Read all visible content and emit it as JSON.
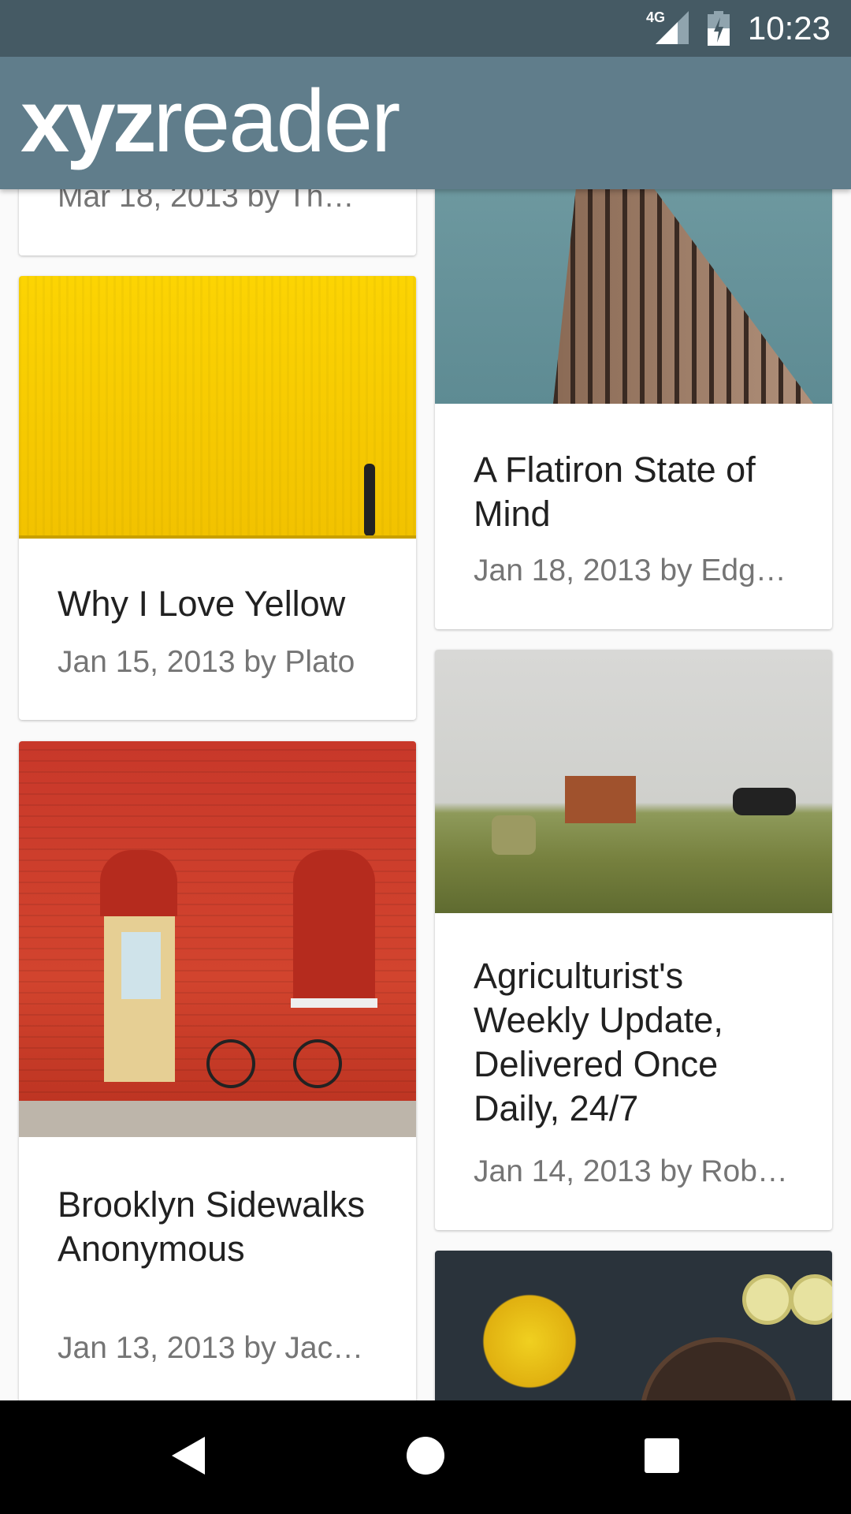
{
  "status_bar": {
    "network": "4G",
    "time": "10:23"
  },
  "toolbar": {
    "logo_bold": "xyz",
    "logo_light": "reader"
  },
  "articles": [
    {
      "title": "",
      "meta": "Mar 18, 2013 by Th…"
    },
    {
      "title": "Why I Love Yellow",
      "meta": "Jan 15, 2013 by Plato"
    },
    {
      "title": "Brooklyn Sidewalks Anonymous",
      "meta": "Jan 13, 2013 by Jac…"
    },
    {
      "title": "A Flatiron State of Mind",
      "meta": "Jan 18, 2013 by Edg…"
    },
    {
      "title": "Agriculturist's Weekly Update, Delivered Once Daily, 24/7",
      "meta": "Jan 14, 2013 by Rob…"
    }
  ],
  "nav": {
    "back": "back-icon",
    "home": "home-icon",
    "recents": "recents-icon"
  }
}
